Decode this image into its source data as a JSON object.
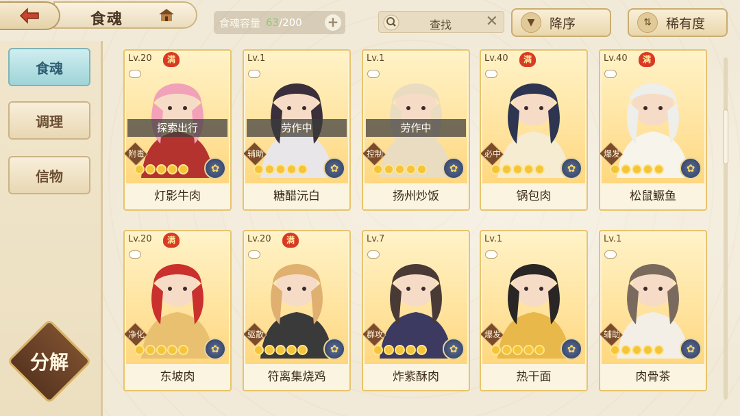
{
  "header": {
    "title": "食魂",
    "capacity_label": "食魂容量",
    "capacity_current": "63",
    "capacity_max": "/200",
    "plus_label": "+",
    "search_placeholder": "查找",
    "search_clear": "✕",
    "sort_desc_label": "降序",
    "sort_rarity_label": "稀有度"
  },
  "sidebar": {
    "tabs": [
      {
        "label": "食魂",
        "active": true
      },
      {
        "label": "调理",
        "active": false
      },
      {
        "label": "信物",
        "active": false
      }
    ],
    "decompose_label": "分解"
  },
  "cards": [
    {
      "level": "Lv.20",
      "full": "满",
      "status": "探索出行",
      "role": "附毒",
      "name": "灯影牛肉",
      "spoons": 5,
      "hair": "#f2a2b8",
      "cloth": "#b4332e"
    },
    {
      "level": "Lv.1",
      "full": "",
      "status": "劳作中",
      "role": "辅助",
      "name": "糖醋沅白",
      "spoons": 5,
      "hair": "#3a2f3a",
      "cloth": "#e9e6ea"
    },
    {
      "level": "Lv.1",
      "full": "",
      "status": "劳作中",
      "role": "控制",
      "name": "扬州炒饭",
      "spoons": 5,
      "hair": "#eadcc0",
      "cloth": "#e9dcc0"
    },
    {
      "level": "Lv.40",
      "full": "满",
      "status": "",
      "role": "必中",
      "name": "锅包肉",
      "spoons": 5,
      "hair": "#2e3550",
      "cloth": "#f5ecd2"
    },
    {
      "level": "Lv.40",
      "full": "满",
      "status": "",
      "role": "爆发",
      "name": "松鼠鳜鱼",
      "spoons": 5,
      "hair": "#eeeeea",
      "cloth": "#f7f4ec"
    },
    {
      "level": "Lv.20",
      "full": "满",
      "status": "",
      "role": "净化",
      "name": "东坡肉",
      "spoons": 5,
      "hair": "#c9302e",
      "cloth": "#e8c070"
    },
    {
      "level": "Lv.20",
      "full": "满",
      "status": "",
      "role": "驱散",
      "name": "符离集烧鸡",
      "spoons": 5,
      "hair": "#e0b070",
      "cloth": "#3a3a3a"
    },
    {
      "level": "Lv.7",
      "full": "",
      "status": "",
      "role": "群攻",
      "name": "炸紫酥肉",
      "spoons": 5,
      "hair": "#4a3a36",
      "cloth": "#3c3a60"
    },
    {
      "level": "Lv.1",
      "full": "",
      "status": "",
      "role": "爆发",
      "name": "热干面",
      "spoons": 5,
      "hair": "#2a2626",
      "cloth": "#e8b84a"
    },
    {
      "level": "Lv.1",
      "full": "",
      "status": "",
      "role": "辅助",
      "name": "肉骨茶",
      "spoons": 5,
      "hair": "#7a6a5e",
      "cloth": "#f3efe6"
    }
  ],
  "element_glyph": "✿",
  "colors": {
    "accent": "#e8c36a",
    "active_tab": "#9fd4d8",
    "capacity_current": "#7ed36a"
  }
}
